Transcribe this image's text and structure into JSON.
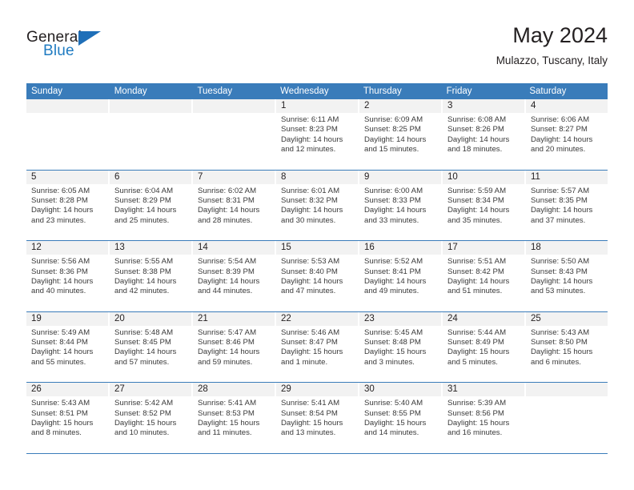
{
  "brand": {
    "name_part1": "General",
    "name_part2": "Blue",
    "triangle_color": "#1f6fb8",
    "blue_text_color": "#1f7bc1"
  },
  "header": {
    "title": "May 2024",
    "subtitle": "Mulazzo, Tuscany, Italy"
  },
  "theme": {
    "header_blue": "#3a7cba",
    "day_number_bg": "#f2f2f2",
    "text_color": "#231f20",
    "body_text_color": "#3a3a3a"
  },
  "weekdays": [
    {
      "label": "Sunday"
    },
    {
      "label": "Monday"
    },
    {
      "label": "Tuesday"
    },
    {
      "label": "Wednesday"
    },
    {
      "label": "Thursday"
    },
    {
      "label": "Friday"
    },
    {
      "label": "Saturday"
    }
  ],
  "weeks": [
    [
      {
        "day": "",
        "sunrise": "",
        "sunset": "",
        "daylight_line1": "",
        "daylight_line2": ""
      },
      {
        "day": "",
        "sunrise": "",
        "sunset": "",
        "daylight_line1": "",
        "daylight_line2": ""
      },
      {
        "day": "",
        "sunrise": "",
        "sunset": "",
        "daylight_line1": "",
        "daylight_line2": ""
      },
      {
        "day": "1",
        "sunrise": "Sunrise: 6:11 AM",
        "sunset": "Sunset: 8:23 PM",
        "daylight_line1": "Daylight: 14 hours",
        "daylight_line2": "and 12 minutes."
      },
      {
        "day": "2",
        "sunrise": "Sunrise: 6:09 AM",
        "sunset": "Sunset: 8:25 PM",
        "daylight_line1": "Daylight: 14 hours",
        "daylight_line2": "and 15 minutes."
      },
      {
        "day": "3",
        "sunrise": "Sunrise: 6:08 AM",
        "sunset": "Sunset: 8:26 PM",
        "daylight_line1": "Daylight: 14 hours",
        "daylight_line2": "and 18 minutes."
      },
      {
        "day": "4",
        "sunrise": "Sunrise: 6:06 AM",
        "sunset": "Sunset: 8:27 PM",
        "daylight_line1": "Daylight: 14 hours",
        "daylight_line2": "and 20 minutes."
      }
    ],
    [
      {
        "day": "5",
        "sunrise": "Sunrise: 6:05 AM",
        "sunset": "Sunset: 8:28 PM",
        "daylight_line1": "Daylight: 14 hours",
        "daylight_line2": "and 23 minutes."
      },
      {
        "day": "6",
        "sunrise": "Sunrise: 6:04 AM",
        "sunset": "Sunset: 8:29 PM",
        "daylight_line1": "Daylight: 14 hours",
        "daylight_line2": "and 25 minutes."
      },
      {
        "day": "7",
        "sunrise": "Sunrise: 6:02 AM",
        "sunset": "Sunset: 8:31 PM",
        "daylight_line1": "Daylight: 14 hours",
        "daylight_line2": "and 28 minutes."
      },
      {
        "day": "8",
        "sunrise": "Sunrise: 6:01 AM",
        "sunset": "Sunset: 8:32 PM",
        "daylight_line1": "Daylight: 14 hours",
        "daylight_line2": "and 30 minutes."
      },
      {
        "day": "9",
        "sunrise": "Sunrise: 6:00 AM",
        "sunset": "Sunset: 8:33 PM",
        "daylight_line1": "Daylight: 14 hours",
        "daylight_line2": "and 33 minutes."
      },
      {
        "day": "10",
        "sunrise": "Sunrise: 5:59 AM",
        "sunset": "Sunset: 8:34 PM",
        "daylight_line1": "Daylight: 14 hours",
        "daylight_line2": "and 35 minutes."
      },
      {
        "day": "11",
        "sunrise": "Sunrise: 5:57 AM",
        "sunset": "Sunset: 8:35 PM",
        "daylight_line1": "Daylight: 14 hours",
        "daylight_line2": "and 37 minutes."
      }
    ],
    [
      {
        "day": "12",
        "sunrise": "Sunrise: 5:56 AM",
        "sunset": "Sunset: 8:36 PM",
        "daylight_line1": "Daylight: 14 hours",
        "daylight_line2": "and 40 minutes."
      },
      {
        "day": "13",
        "sunrise": "Sunrise: 5:55 AM",
        "sunset": "Sunset: 8:38 PM",
        "daylight_line1": "Daylight: 14 hours",
        "daylight_line2": "and 42 minutes."
      },
      {
        "day": "14",
        "sunrise": "Sunrise: 5:54 AM",
        "sunset": "Sunset: 8:39 PM",
        "daylight_line1": "Daylight: 14 hours",
        "daylight_line2": "and 44 minutes."
      },
      {
        "day": "15",
        "sunrise": "Sunrise: 5:53 AM",
        "sunset": "Sunset: 8:40 PM",
        "daylight_line1": "Daylight: 14 hours",
        "daylight_line2": "and 47 minutes."
      },
      {
        "day": "16",
        "sunrise": "Sunrise: 5:52 AM",
        "sunset": "Sunset: 8:41 PM",
        "daylight_line1": "Daylight: 14 hours",
        "daylight_line2": "and 49 minutes."
      },
      {
        "day": "17",
        "sunrise": "Sunrise: 5:51 AM",
        "sunset": "Sunset: 8:42 PM",
        "daylight_line1": "Daylight: 14 hours",
        "daylight_line2": "and 51 minutes."
      },
      {
        "day": "18",
        "sunrise": "Sunrise: 5:50 AM",
        "sunset": "Sunset: 8:43 PM",
        "daylight_line1": "Daylight: 14 hours",
        "daylight_line2": "and 53 minutes."
      }
    ],
    [
      {
        "day": "19",
        "sunrise": "Sunrise: 5:49 AM",
        "sunset": "Sunset: 8:44 PM",
        "daylight_line1": "Daylight: 14 hours",
        "daylight_line2": "and 55 minutes."
      },
      {
        "day": "20",
        "sunrise": "Sunrise: 5:48 AM",
        "sunset": "Sunset: 8:45 PM",
        "daylight_line1": "Daylight: 14 hours",
        "daylight_line2": "and 57 minutes."
      },
      {
        "day": "21",
        "sunrise": "Sunrise: 5:47 AM",
        "sunset": "Sunset: 8:46 PM",
        "daylight_line1": "Daylight: 14 hours",
        "daylight_line2": "and 59 minutes."
      },
      {
        "day": "22",
        "sunrise": "Sunrise: 5:46 AM",
        "sunset": "Sunset: 8:47 PM",
        "daylight_line1": "Daylight: 15 hours",
        "daylight_line2": "and 1 minute."
      },
      {
        "day": "23",
        "sunrise": "Sunrise: 5:45 AM",
        "sunset": "Sunset: 8:48 PM",
        "daylight_line1": "Daylight: 15 hours",
        "daylight_line2": "and 3 minutes."
      },
      {
        "day": "24",
        "sunrise": "Sunrise: 5:44 AM",
        "sunset": "Sunset: 8:49 PM",
        "daylight_line1": "Daylight: 15 hours",
        "daylight_line2": "and 5 minutes."
      },
      {
        "day": "25",
        "sunrise": "Sunrise: 5:43 AM",
        "sunset": "Sunset: 8:50 PM",
        "daylight_line1": "Daylight: 15 hours",
        "daylight_line2": "and 6 minutes."
      }
    ],
    [
      {
        "day": "26",
        "sunrise": "Sunrise: 5:43 AM",
        "sunset": "Sunset: 8:51 PM",
        "daylight_line1": "Daylight: 15 hours",
        "daylight_line2": "and 8 minutes."
      },
      {
        "day": "27",
        "sunrise": "Sunrise: 5:42 AM",
        "sunset": "Sunset: 8:52 PM",
        "daylight_line1": "Daylight: 15 hours",
        "daylight_line2": "and 10 minutes."
      },
      {
        "day": "28",
        "sunrise": "Sunrise: 5:41 AM",
        "sunset": "Sunset: 8:53 PM",
        "daylight_line1": "Daylight: 15 hours",
        "daylight_line2": "and 11 minutes."
      },
      {
        "day": "29",
        "sunrise": "Sunrise: 5:41 AM",
        "sunset": "Sunset: 8:54 PM",
        "daylight_line1": "Daylight: 15 hours",
        "daylight_line2": "and 13 minutes."
      },
      {
        "day": "30",
        "sunrise": "Sunrise: 5:40 AM",
        "sunset": "Sunset: 8:55 PM",
        "daylight_line1": "Daylight: 15 hours",
        "daylight_line2": "and 14 minutes."
      },
      {
        "day": "31",
        "sunrise": "Sunrise: 5:39 AM",
        "sunset": "Sunset: 8:56 PM",
        "daylight_line1": "Daylight: 15 hours",
        "daylight_line2": "and 16 minutes."
      },
      {
        "day": "",
        "sunrise": "",
        "sunset": "",
        "daylight_line1": "",
        "daylight_line2": ""
      }
    ]
  ]
}
